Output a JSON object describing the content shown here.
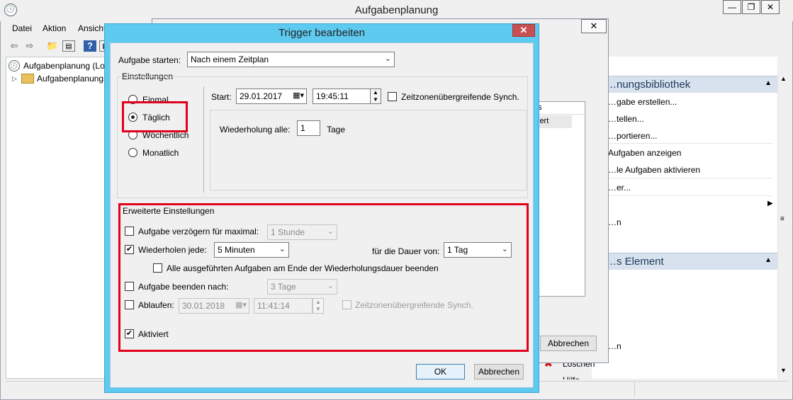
{
  "main_window": {
    "title": "Aufgabenplanung",
    "window_buttons": [
      "—",
      "❐",
      "✕"
    ],
    "menu": [
      "Datei",
      "Aktion",
      "Ansicht"
    ],
    "tree": {
      "root": "Aufgabenplanung (Lokal)",
      "child": "Aufgabenplanungsbibliothek"
    },
    "actions": {
      "header1": "…nungsbibliothek",
      "items1": [
        "…gabe erstellen...",
        "…tellen...",
        "…portieren...",
        "Aufgaben anzeigen",
        "…le Aufgaben aktivieren",
        "…er...",
        "…n"
      ],
      "header2": "…s Element",
      "items2": [
        "…n",
        "Löschen",
        "Hilfe"
      ]
    }
  },
  "back_dialog": {
    "close": "✕",
    "list_header": "s",
    "list_cell": "iert",
    "cancel_button": "Abbrechen"
  },
  "trigger_dialog": {
    "title": "Trigger bearbeiten",
    "close": "✕",
    "start_task_label": "Aufgabe starten:",
    "start_task_value": "Nach einem Zeitplan",
    "settings": {
      "group_label": "Einstellungen",
      "radios": [
        "Einmal",
        "Täglich",
        "Wöchentlich",
        "Monatlich"
      ],
      "selected": "Täglich",
      "start_label": "Start:",
      "start_date": "29.01.2017",
      "start_time": "19:45:11",
      "sync_label": "Zeitzonenübergreifende Synch.",
      "repeat_every_label": "Wiederholung alle:",
      "repeat_every_value": "1",
      "repeat_unit": "Tage"
    },
    "advanced": {
      "group_label": "Erweiterte Einstellungen",
      "delay_label": "Aufgabe verzögern für maximal:",
      "delay_value": "1 Stunde",
      "delay_checked": false,
      "repeat_label": "Wiederholen jede:",
      "repeat_value": "5 Minuten",
      "repeat_checked": true,
      "duration_label": "für die Dauer von:",
      "duration_value": "1 Tag",
      "stop_all_label": "Alle ausgeführten Aufgaben am Ende der Wiederholungsdauer beenden",
      "stop_after_label": "Aufgabe beenden nach:",
      "stop_after_value": "3 Tage",
      "expire_label": "Ablaufen:",
      "expire_date": "30.01.2018",
      "expire_time": "11:41:14",
      "expire_sync_label": "Zeitzonenübergreifende Synch.",
      "enabled_label": "Aktiviert",
      "enabled_checked": true
    },
    "ok_button": "OK",
    "cancel_button": "Abbrechen"
  },
  "colors": {
    "dialog_frame": "#5ecaf0",
    "highlight": "#e2001a",
    "close_button": "#c75050"
  }
}
